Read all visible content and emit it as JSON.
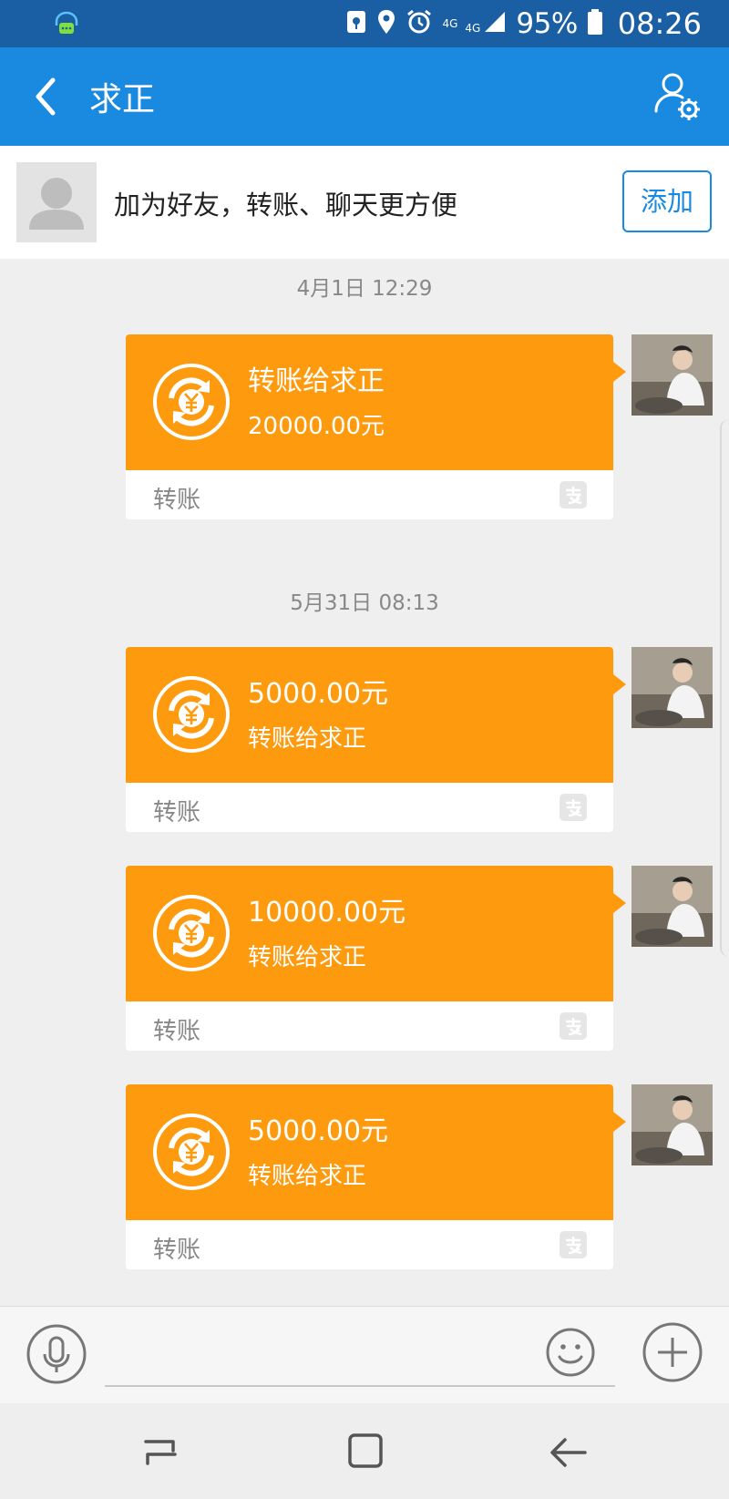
{
  "status_bar": {
    "network_top": "4G",
    "network_bottom": "4G",
    "battery": "95%",
    "time": "08:26",
    "icons": [
      "chat-notification-icon",
      "vpn-key-icon",
      "location-icon",
      "alarm-icon",
      "signal-icon",
      "battery-icon"
    ]
  },
  "nav": {
    "title": "求正",
    "back_icon": "back-arrow-icon",
    "settings_icon": "user-settings-icon"
  },
  "banner": {
    "text": "加为好友，转账、聊天更方便",
    "button": "添加"
  },
  "chat": {
    "time_labels": [
      "4月1日 12:29",
      "5月31日 08:13"
    ],
    "messages": [
      {
        "line1": "转账给求正",
        "line2": "20000.00元",
        "footer": "转账"
      },
      {
        "line1": "5000.00元",
        "line2": "转账给求正",
        "footer": "转账"
      },
      {
        "line1": "10000.00元",
        "line2": "转账给求正",
        "footer": "转账"
      },
      {
        "line1": "5000.00元",
        "line2": "转账给求正",
        "footer": "转账"
      }
    ]
  },
  "colors": {
    "status_bar": "#1a5fa3",
    "nav_bar": "#1a8ae0",
    "card": "#fe9a0e",
    "background": "#efefef"
  }
}
